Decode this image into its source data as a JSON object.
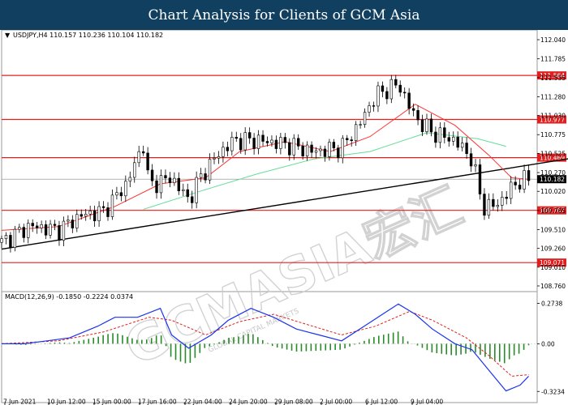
{
  "banner": {
    "title": "Chart Analysis for Clients of GCM Asia"
  },
  "watermark": {
    "text": "GCMASIA宏汇",
    "subtext": "GLOBAL CAPITAL MARKETS"
  },
  "colors": {
    "banner_bg": "#113f5f",
    "price": "#000000",
    "sma_red": "#ff3333",
    "sma_green": "#66dd99",
    "level_line": "#e02020",
    "trendline": "#000000",
    "macd_line": "#1a33ee",
    "signal_line": "#e02020",
    "histogram": "#2a8a2a"
  },
  "chart_data": [
    {
      "type": "line",
      "title": "USDJPY,H4  110.157 110.236 110.104 110.182",
      "symbol_text": "USDJPY,H4",
      "ohlc_text": "110.157 110.236 110.104 110.182",
      "dropdown_icon": "triangle-down-icon",
      "x": [
        "7 Jun 2021",
        "10 Jun 12:00",
        "15 Jun 00:00",
        "17 Jun 16:00",
        "22 Jun 04:00",
        "24 Jun 20:00",
        "29 Jun 08:00",
        "2 Jul 00:00",
        "6 Jul 12:00",
        "9 Jul 04:00"
      ],
      "ylim": [
        108.76,
        112.04
      ],
      "yticks": [
        "112.040",
        "111.785",
        "111.535",
        "111.280",
        "111.030",
        "110.775",
        "110.525",
        "110.270",
        "110.020",
        "109.765",
        "109.510",
        "109.260",
        "109.010",
        "108.760"
      ],
      "current_price": "110.182",
      "price_key_points": [
        {
          "x": 0,
          "y": 109.34
        },
        {
          "x": 0.5,
          "y": 109.56
        },
        {
          "x": 1.0,
          "y": 109.5
        },
        {
          "x": 1.4,
          "y": 109.7
        },
        {
          "x": 1.8,
          "y": 109.75
        },
        {
          "x": 2.2,
          "y": 110.12
        },
        {
          "x": 2.5,
          "y": 110.65
        },
        {
          "x": 2.6,
          "y": 110.1
        },
        {
          "x": 3.0,
          "y": 110.2
        },
        {
          "x": 3.3,
          "y": 109.9
        },
        {
          "x": 3.5,
          "y": 110.2
        },
        {
          "x": 3.8,
          "y": 110.5
        },
        {
          "x": 4.1,
          "y": 110.7
        },
        {
          "x": 4.5,
          "y": 110.7
        },
        {
          "x": 5.0,
          "y": 110.65
        },
        {
          "x": 5.5,
          "y": 110.55
        },
        {
          "x": 6.0,
          "y": 110.6
        },
        {
          "x": 6.3,
          "y": 110.9
        },
        {
          "x": 6.6,
          "y": 111.3
        },
        {
          "x": 7.0,
          "y": 111.45
        },
        {
          "x": 7.3,
          "y": 111.0
        },
        {
          "x": 7.6,
          "y": 110.8
        },
        {
          "x": 8.0,
          "y": 110.7
        },
        {
          "x": 8.3,
          "y": 110.45
        },
        {
          "x": 8.5,
          "y": 109.8
        },
        {
          "x": 8.75,
          "y": 109.85
        },
        {
          "x": 9.1,
          "y": 110.15
        },
        {
          "x": 9.3,
          "y": 110.18
        }
      ],
      "sma_red": [
        {
          "x": 0,
          "y": 109.5
        },
        {
          "x": 1.0,
          "y": 109.55
        },
        {
          "x": 2.0,
          "y": 109.82
        },
        {
          "x": 2.8,
          "y": 110.12
        },
        {
          "x": 3.6,
          "y": 110.2
        },
        {
          "x": 4.2,
          "y": 110.55
        },
        {
          "x": 5.0,
          "y": 110.68
        },
        {
          "x": 5.8,
          "y": 110.55
        },
        {
          "x": 6.5,
          "y": 110.75
        },
        {
          "x": 7.3,
          "y": 111.18
        },
        {
          "x": 8.0,
          "y": 110.9
        },
        {
          "x": 8.6,
          "y": 110.5
        },
        {
          "x": 9.0,
          "y": 110.2
        },
        {
          "x": 9.3,
          "y": 110.18
        }
      ],
      "sma_green": [
        {
          "x": 2.5,
          "y": 109.78
        },
        {
          "x": 3.5,
          "y": 110.02
        },
        {
          "x": 4.5,
          "y": 110.25
        },
        {
          "x": 5.5,
          "y": 110.45
        },
        {
          "x": 6.5,
          "y": 110.55
        },
        {
          "x": 7.5,
          "y": 110.8
        },
        {
          "x": 8.4,
          "y": 110.72
        },
        {
          "x": 8.9,
          "y": 110.62
        }
      ],
      "levels": [
        {
          "label": "111.564",
          "value": 111.564
        },
        {
          "label": "110.977",
          "value": 110.977
        },
        {
          "label": "110.469",
          "value": 110.469
        },
        {
          "label": "109.767",
          "value": 109.767
        },
        {
          "label": "109.071",
          "value": 109.071
        }
      ],
      "trendline": [
        {
          "x": 0,
          "y": 109.25
        },
        {
          "x": 10.8,
          "y": 110.55
        }
      ],
      "legend": "none",
      "grid": false
    },
    {
      "type": "line",
      "title": "MACD(12,26,9) -0.1850 -0.2224 0.0374",
      "ylim": [
        -0.355,
        0.31
      ],
      "yticks": [
        "0.2738",
        "0.00",
        "-0.3234"
      ],
      "macd_line": [
        {
          "x": 0,
          "y": 0.0
        },
        {
          "x": 0.4,
          "y": 0.0
        },
        {
          "x": 0.8,
          "y": 0.02
        },
        {
          "x": 1.2,
          "y": 0.04
        },
        {
          "x": 1.7,
          "y": 0.12
        },
        {
          "x": 2.0,
          "y": 0.18
        },
        {
          "x": 2.4,
          "y": 0.18
        },
        {
          "x": 2.8,
          "y": 0.24
        },
        {
          "x": 3.0,
          "y": 0.06
        },
        {
          "x": 3.3,
          "y": -0.03
        },
        {
          "x": 3.7,
          "y": 0.06
        },
        {
          "x": 4.0,
          "y": 0.16
        },
        {
          "x": 4.4,
          "y": 0.24
        },
        {
          "x": 4.8,
          "y": 0.18
        },
        {
          "x": 5.2,
          "y": 0.1
        },
        {
          "x": 5.6,
          "y": 0.06
        },
        {
          "x": 6.0,
          "y": 0.02
        },
        {
          "x": 6.4,
          "y": 0.12
        },
        {
          "x": 6.8,
          "y": 0.22
        },
        {
          "x": 7.0,
          "y": 0.27
        },
        {
          "x": 7.3,
          "y": 0.2
        },
        {
          "x": 7.6,
          "y": 0.1
        },
        {
          "x": 8.0,
          "y": 0.0
        },
        {
          "x": 8.3,
          "y": -0.04
        },
        {
          "x": 8.6,
          "y": -0.18
        },
        {
          "x": 8.9,
          "y": -0.32
        },
        {
          "x": 9.15,
          "y": -0.28
        },
        {
          "x": 9.3,
          "y": -0.22
        }
      ],
      "signal_line": [
        {
          "x": 0,
          "y": 0.0
        },
        {
          "x": 1.0,
          "y": 0.02
        },
        {
          "x": 1.8,
          "y": 0.08
        },
        {
          "x": 2.6,
          "y": 0.18
        },
        {
          "x": 3.0,
          "y": 0.16
        },
        {
          "x": 3.6,
          "y": 0.06
        },
        {
          "x": 4.2,
          "y": 0.15
        },
        {
          "x": 4.8,
          "y": 0.2
        },
        {
          "x": 5.4,
          "y": 0.13
        },
        {
          "x": 6.0,
          "y": 0.06
        },
        {
          "x": 6.6,
          "y": 0.12
        },
        {
          "x": 7.2,
          "y": 0.22
        },
        {
          "x": 7.6,
          "y": 0.16
        },
        {
          "x": 8.2,
          "y": 0.04
        },
        {
          "x": 8.6,
          "y": -0.08
        },
        {
          "x": 9.0,
          "y": -0.22
        },
        {
          "x": 9.3,
          "y": -0.21
        }
      ],
      "legend": "none",
      "grid": false
    }
  ]
}
